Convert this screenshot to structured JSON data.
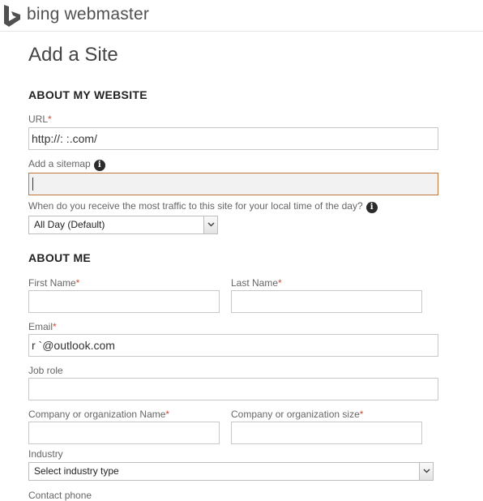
{
  "header": {
    "brand": "bing webmaster"
  },
  "page": {
    "title": "Add a Site"
  },
  "website_section": {
    "heading": "ABOUT MY WEBSITE",
    "url": {
      "label": "URL",
      "required": "*",
      "value": "http://:              :.com/"
    },
    "sitemap": {
      "label": "Add a sitemap",
      "value": ""
    },
    "traffic": {
      "label": "When do you receive the most traffic to this site for your local time of the day?",
      "selected": "All Day (Default)"
    }
  },
  "about_me": {
    "heading": "ABOUT ME",
    "first_name": {
      "label": "First Name",
      "required": "*",
      "value": ""
    },
    "last_name": {
      "label": "Last Name",
      "required": "*",
      "value": ""
    },
    "email": {
      "label": "Email",
      "required": "*",
      "value": "r                   `@outlook.com"
    },
    "job_role": {
      "label": "Job role",
      "value": ""
    },
    "company_name": {
      "label": "Company or organization Name",
      "required": "*",
      "value": ""
    },
    "company_size": {
      "label": "Company or organization size",
      "required": "*",
      "value": ""
    },
    "industry": {
      "label": "Industry",
      "selected": "Select industry type"
    },
    "contact_phone": {
      "label": "Contact phone"
    }
  },
  "icons": {
    "info": "info-icon",
    "logo": "bing-logo-icon",
    "dropdown": "chevron-down-icon"
  },
  "colors": {
    "required": "#c8503a",
    "focus_border": "#c0753a",
    "focus_bg": "#f2f2f2"
  }
}
